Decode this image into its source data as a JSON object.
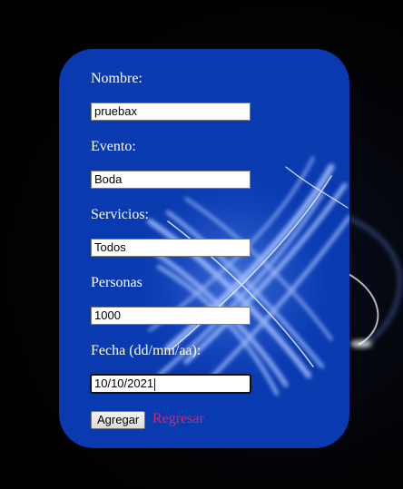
{
  "form": {
    "fields": [
      {
        "label": "Nombre:",
        "value": "pruebax"
      },
      {
        "label": "Evento:",
        "value": "Boda"
      },
      {
        "label": "Servicios:",
        "value": "Todos"
      },
      {
        "label": "Personas",
        "value": "1000"
      },
      {
        "label": "Fecha (dd/mm/aa):",
        "value": "10/10/2021"
      }
    ],
    "submit_label": "Agregar",
    "back_link_label": "Regresar"
  },
  "colors": {
    "background": "#000000",
    "panel": "#0a3ab0",
    "label_text": "#ffffff",
    "link": "#e0245a"
  }
}
